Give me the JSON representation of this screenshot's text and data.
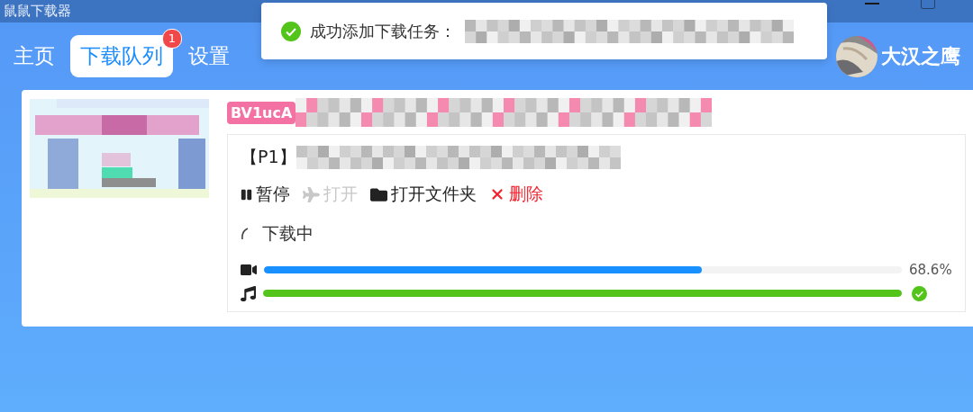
{
  "window": {
    "title": "鼠鼠下载器"
  },
  "nav": {
    "tabs": [
      {
        "label": "主页",
        "selected": false
      },
      {
        "label": "下载队列",
        "selected": true,
        "badge": "1"
      },
      {
        "label": "设置",
        "selected": false
      }
    ]
  },
  "user": {
    "name": "大汉之鹰"
  },
  "toast": {
    "kind": "success",
    "message": "成功添加下载任务："
  },
  "task": {
    "tag": "BV1ucA",
    "part": "【P1】",
    "actions": [
      {
        "label": "暂停",
        "kind": "pause",
        "disabled": false
      },
      {
        "label": "打开",
        "kind": "open",
        "disabled": true
      },
      {
        "label": "打开文件夹",
        "kind": "folder",
        "disabled": false
      },
      {
        "label": "删除",
        "kind": "delete",
        "disabled": false
      }
    ],
    "status": "下载中",
    "progress": [
      {
        "kind": "video",
        "level": 0.686,
        "reading": "68.6%",
        "done": false
      },
      {
        "kind": "audio",
        "level": 1,
        "done": true
      }
    ]
  }
}
